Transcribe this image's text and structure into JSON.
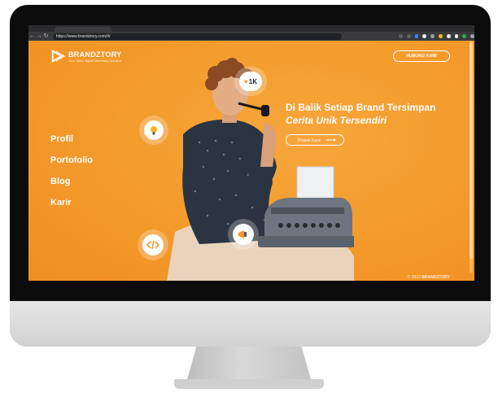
{
  "browser": {
    "url": "https://www.brandztory.com/#/"
  },
  "site": {
    "logo_name": "BRANDZTORY",
    "logo_tagline": "Your Story Digital Marketing Solution",
    "contact_button": "HUBUNGI KAMI",
    "nav": [
      "Profil",
      "Portofolio",
      "Blog",
      "Karir"
    ],
    "headline_line1": "Di Balik Setiap Brand Tersimpan",
    "headline_line2": "Cerita Unik Tersendiri",
    "cta_label": "Proyek Kami",
    "like_count": "1K",
    "copyright_prefix": "© 2022",
    "copyright_brand": "BRANDZTORY"
  },
  "icons": {
    "idea": "lightbulb-icon",
    "code": "code-icon",
    "like": "heart-icon",
    "mega": "megaphone-icon"
  },
  "colors": {
    "accent": "#f39a2b",
    "monitor_bezel": "#0c0c0c",
    "monitor_chin": "#dcdcdc"
  }
}
